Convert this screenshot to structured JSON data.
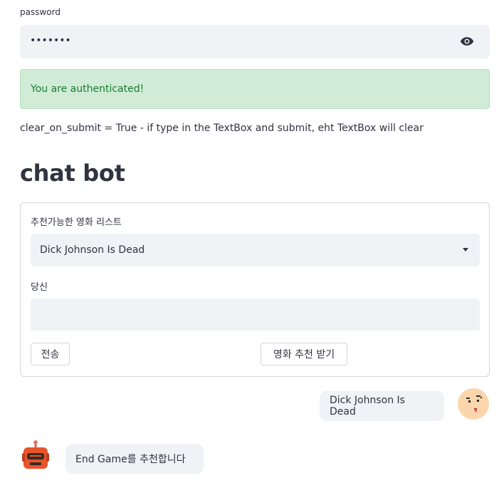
{
  "password": {
    "label": "password",
    "value": "•••••••",
    "toggle_icon": "eye-icon"
  },
  "alert": {
    "text": "You are authenticated!",
    "color": "#1a7c32",
    "background": "#d0ecd6"
  },
  "note": "clear_on_submit = True - if type in the TextBox and submit, eht TextBox will clear",
  "heading": "chat bot",
  "form": {
    "select_label": "추천가능한 영화 리스트",
    "select_value": "Dick Johnson Is Dead",
    "input_label": "당신",
    "input_value": "",
    "submit_label": "전송",
    "recommend_label": "영화 추천 받기"
  },
  "messages": [
    {
      "role": "user",
      "text": "Dick Johnson Is Dead",
      "avatar": "user-face-avatar"
    },
    {
      "role": "bot",
      "text": "End Game를 추천합니다",
      "avatar": "robot-avatar"
    }
  ]
}
